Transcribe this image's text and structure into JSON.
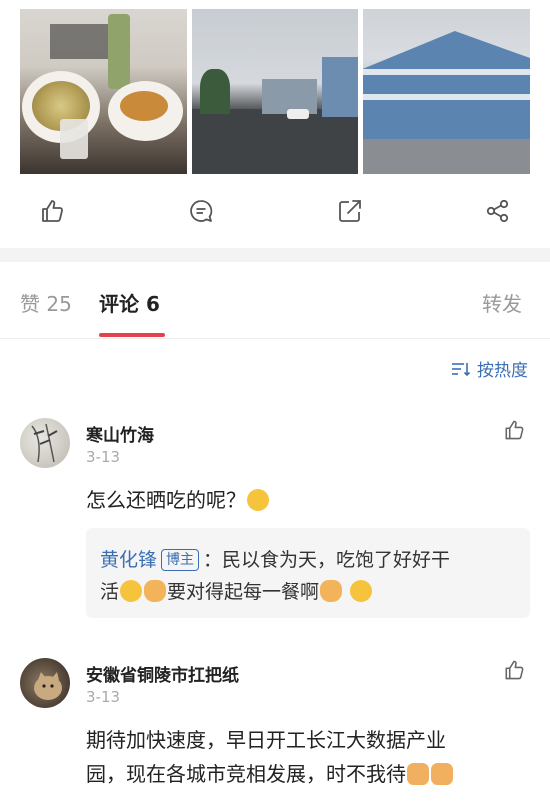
{
  "photos": [
    {
      "alt": "food-photo"
    },
    {
      "alt": "street-photo"
    },
    {
      "alt": "building-photo"
    }
  ],
  "actions": [
    "like",
    "comment",
    "share",
    "forward"
  ],
  "tabs": {
    "likes": "赞 25",
    "comments": "评论 6",
    "repost": "转发"
  },
  "sort_label": "按热度",
  "comments": [
    {
      "user": "寒山竹海",
      "date": "3-13",
      "text": "怎么还晒吃的呢？",
      "reply": {
        "user": "黄化锋",
        "badge": "博主",
        "text_part1": "：民以食为天，吃饱了好好干",
        "text_part2": "活",
        "text_part3": "要对得起每一餐啊"
      }
    },
    {
      "user": "安徽省铜陵市扛把纸",
      "date": "3-13",
      "text_line1": "期待加快速度，早日开工长江大数据产业",
      "text_line2": "园，现在各城市竞相发展，时不我待"
    }
  ],
  "colors": {
    "accent": "#e4414f",
    "link": "#3b6fb5",
    "muted": "#999999"
  }
}
